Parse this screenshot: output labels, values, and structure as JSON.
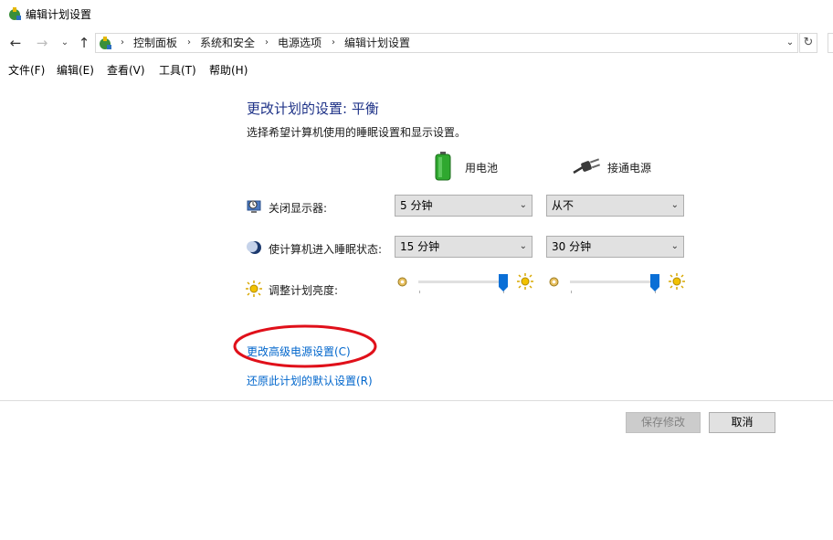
{
  "window": {
    "title": "编辑计划设置"
  },
  "nav": {
    "back_icon": "back-arrow-icon",
    "forward_icon": "forward-arrow-icon",
    "recent_icon": "chevron-down-icon",
    "up_icon": "up-arrow-icon",
    "breadcrumbs": [
      "控制面板",
      "系统和安全",
      "电源选项",
      "编辑计划设置"
    ]
  },
  "menu": {
    "items": [
      "文件(F)",
      "编辑(E)",
      "查看(V)",
      "工具(T)",
      "帮助(H)"
    ]
  },
  "main": {
    "heading": "更改计划的设置: 平衡",
    "subtitle": "选择希望计算机使用的睡眠设置和显示设置。",
    "columns": {
      "battery": "用电池",
      "plugged": "接通电源"
    },
    "rows": {
      "display_off": {
        "label": "关闭显示器:",
        "battery": "5 分钟",
        "plugged": "从不"
      },
      "sleep": {
        "label": "使计算机进入睡眠状态:",
        "battery": "15 分钟",
        "plugged": "30 分钟"
      },
      "brightness": {
        "label": "调整计划亮度:",
        "battery_level": 1.0,
        "plugged_level": 1.0
      }
    },
    "links": {
      "advanced": "更改高级电源设置(C)",
      "restore": "还原此计划的默认设置(R)"
    },
    "buttons": {
      "save": "保存修改",
      "cancel": "取消"
    }
  },
  "colors": {
    "heading": "#1e3287",
    "link": "#0066cc",
    "slider_thumb": "#0a6fd6",
    "annotation": "#e0101a"
  }
}
